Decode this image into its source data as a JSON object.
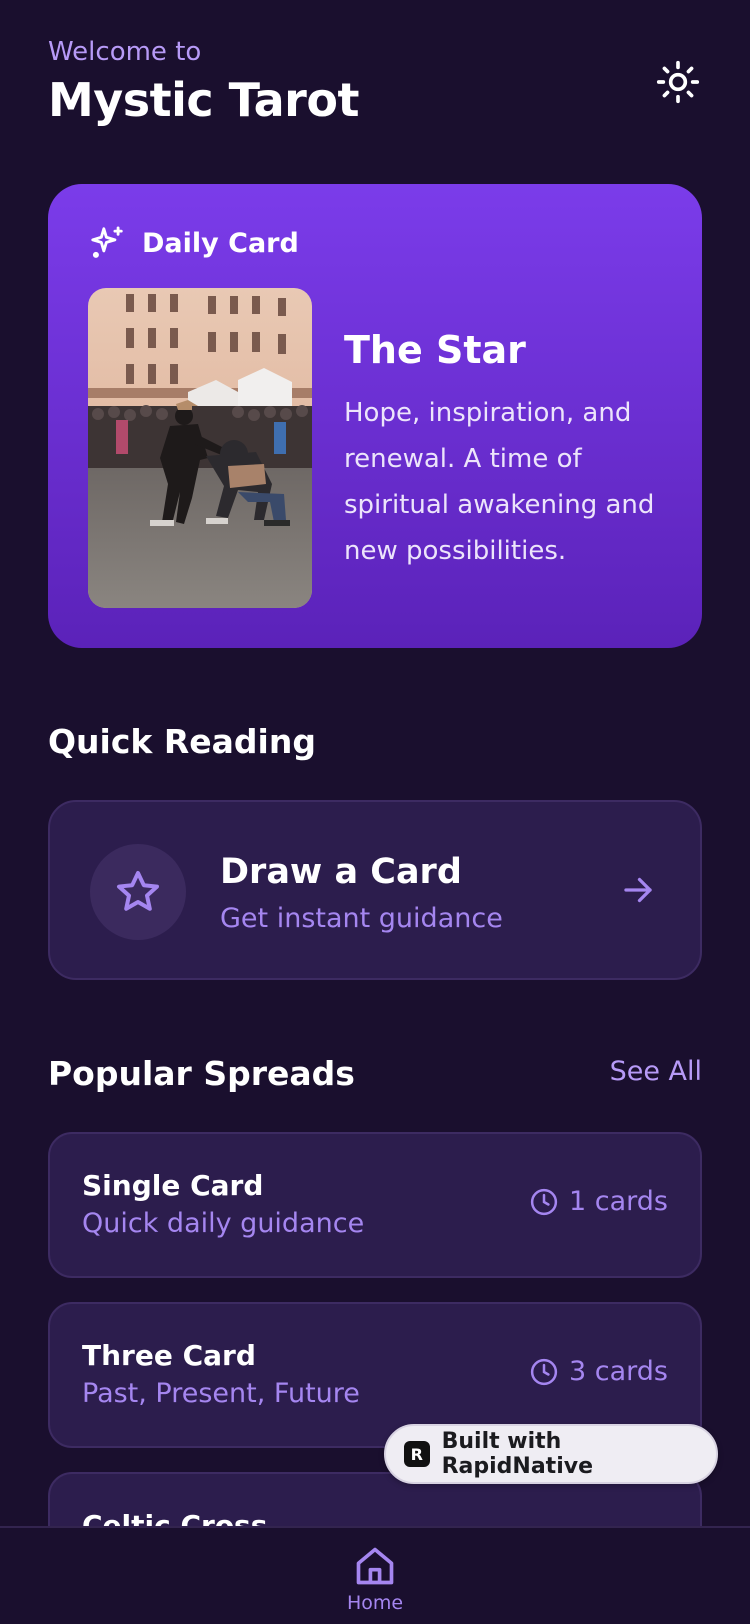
{
  "header": {
    "welcome": "Welcome to",
    "title": "Mystic Tarot"
  },
  "daily_card": {
    "label": "Daily Card",
    "card_name": "The Star",
    "description": "Hope, inspiration, and renewal. A time of spiritual awakening and new possibilities."
  },
  "quick_reading": {
    "title": "Quick Reading",
    "draw_title": "Draw a Card",
    "draw_subtitle": "Get instant guidance"
  },
  "popular_spreads": {
    "title": "Popular Spreads",
    "see_all": "See All",
    "items": [
      {
        "name": "Single Card",
        "description": "Quick daily guidance",
        "count": "1 cards"
      },
      {
        "name": "Three Card",
        "description": "Past, Present, Future",
        "count": "3 cards"
      },
      {
        "name": "Celtic Cross"
      }
    ]
  },
  "badge": {
    "logo": "R",
    "label": "Built with RapidNative"
  },
  "nav": {
    "home_label": "Home"
  },
  "colors": {
    "background": "#1a0f2e",
    "card_gradient_top": "#7b3cea",
    "card_gradient_bottom": "#5b22b9",
    "accent": "#a586f0",
    "surface": "#2c1d4d"
  },
  "icons": {
    "theme": "sun-icon",
    "daily": "sparkles-icon",
    "draw": "star-icon",
    "draw_action": "arrow-right-icon",
    "spread_count": "clock-icon",
    "nav_home": "home-icon"
  }
}
